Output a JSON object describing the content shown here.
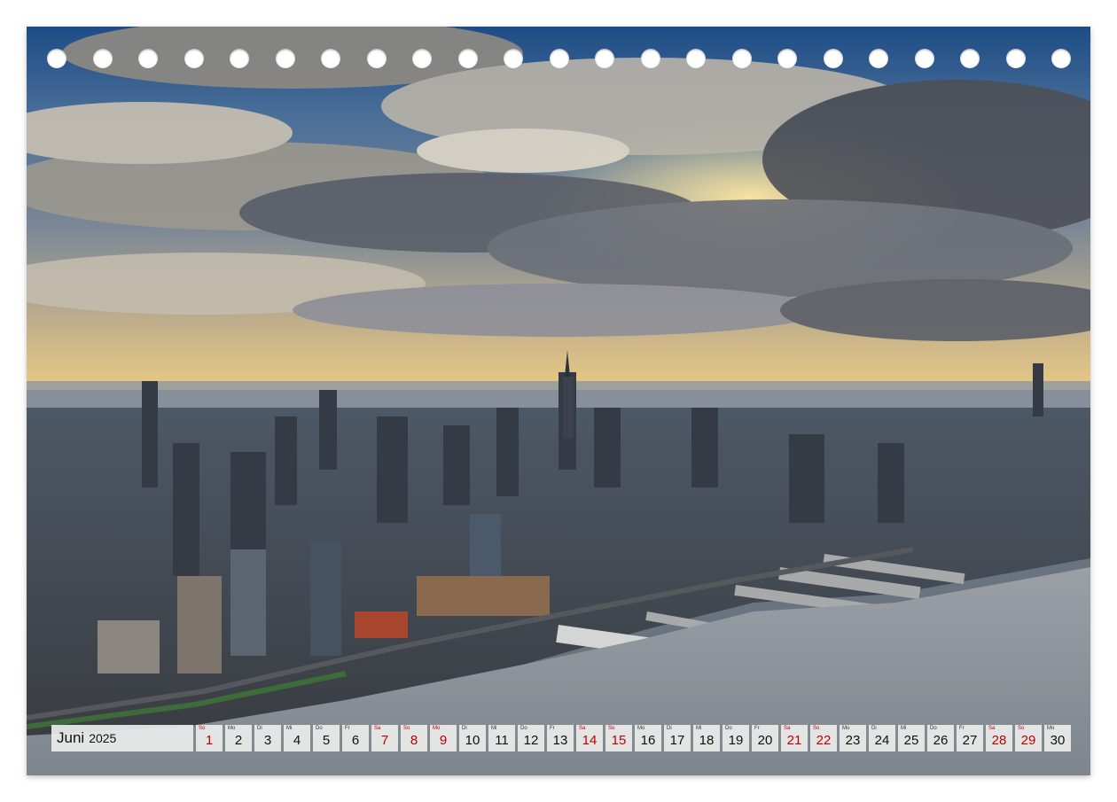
{
  "calendar": {
    "month": "Juni",
    "year": "2025",
    "days": [
      {
        "n": "1",
        "d": "So",
        "red": true
      },
      {
        "n": "2",
        "d": "Mo",
        "red": false
      },
      {
        "n": "3",
        "d": "Di",
        "red": false
      },
      {
        "n": "4",
        "d": "Mi",
        "red": false
      },
      {
        "n": "5",
        "d": "Do",
        "red": false
      },
      {
        "n": "6",
        "d": "Fr",
        "red": false
      },
      {
        "n": "7",
        "d": "Sa",
        "red": true
      },
      {
        "n": "8",
        "d": "So",
        "red": true
      },
      {
        "n": "9",
        "d": "Mo",
        "red": true
      },
      {
        "n": "10",
        "d": "Di",
        "red": false
      },
      {
        "n": "11",
        "d": "Mi",
        "red": false
      },
      {
        "n": "12",
        "d": "Do",
        "red": false
      },
      {
        "n": "13",
        "d": "Fr",
        "red": false
      },
      {
        "n": "14",
        "d": "Sa",
        "red": true
      },
      {
        "n": "15",
        "d": "So",
        "red": true
      },
      {
        "n": "16",
        "d": "Mo",
        "red": false
      },
      {
        "n": "17",
        "d": "Di",
        "red": false
      },
      {
        "n": "18",
        "d": "Mi",
        "red": false
      },
      {
        "n": "19",
        "d": "Do",
        "red": false
      },
      {
        "n": "20",
        "d": "Fr",
        "red": false
      },
      {
        "n": "21",
        "d": "Sa",
        "red": true
      },
      {
        "n": "22",
        "d": "So",
        "red": true
      },
      {
        "n": "23",
        "d": "Mo",
        "red": false
      },
      {
        "n": "24",
        "d": "Di",
        "red": false
      },
      {
        "n": "25",
        "d": "Mi",
        "red": false
      },
      {
        "n": "26",
        "d": "Do",
        "red": false
      },
      {
        "n": "27",
        "d": "Fr",
        "red": false
      },
      {
        "n": "28",
        "d": "Sa",
        "red": true
      },
      {
        "n": "29",
        "d": "So",
        "red": true
      },
      {
        "n": "30",
        "d": "Mo",
        "red": false
      }
    ]
  },
  "colors": {
    "holiday_red": "#c00000",
    "sky_blue": "#1e4f8c",
    "river": "#8a9199"
  }
}
